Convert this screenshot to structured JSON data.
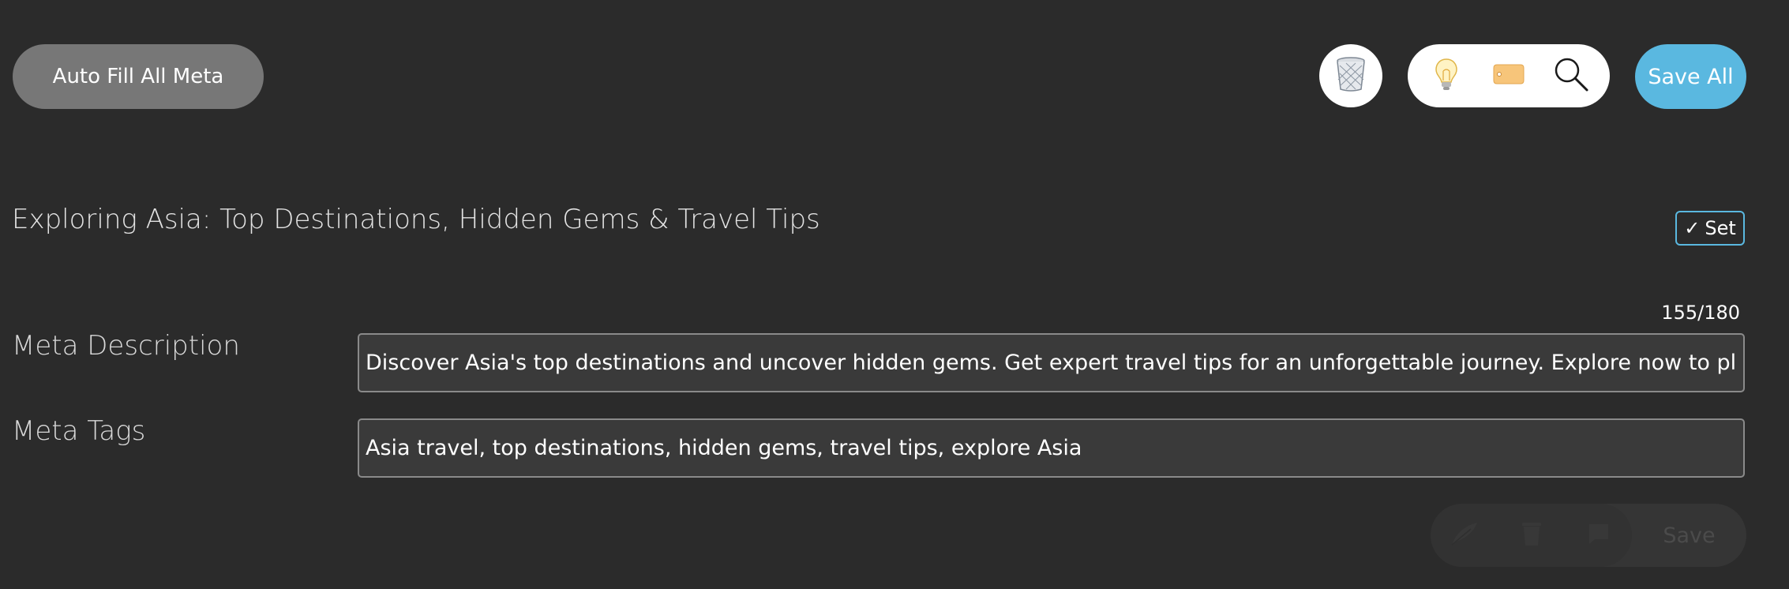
{
  "toolbar": {
    "autofill_label": "Auto Fill All Meta",
    "save_all_label": "Save All",
    "icons": {
      "trash": "trash-icon",
      "bulb": "lightbulb-icon",
      "tag": "tag-icon",
      "search": "search-icon"
    }
  },
  "post": {
    "title": "Exploring Asia: Top Destinations, Hidden Gems & Travel Tips",
    "set_label": "Set",
    "set_check": "✓"
  },
  "meta_description": {
    "label": "Meta Description",
    "value": "Discover Asia's top destinations and uncover hidden gems. Get expert travel tips for an unforgettable journey. Explore now to plan your next adventure!",
    "counter": "155/180"
  },
  "meta_tags": {
    "label": "Meta Tags",
    "value": "Asia travel, top destinations, hidden gems, travel tips, explore Asia"
  },
  "bottom_actions": {
    "save_label": "Save",
    "icons": [
      "feather-icon",
      "trash-icon",
      "comment-icon"
    ]
  },
  "colors": {
    "background": "#2b2b2b",
    "accent": "#5ab8e0",
    "button_gray": "#777777"
  }
}
